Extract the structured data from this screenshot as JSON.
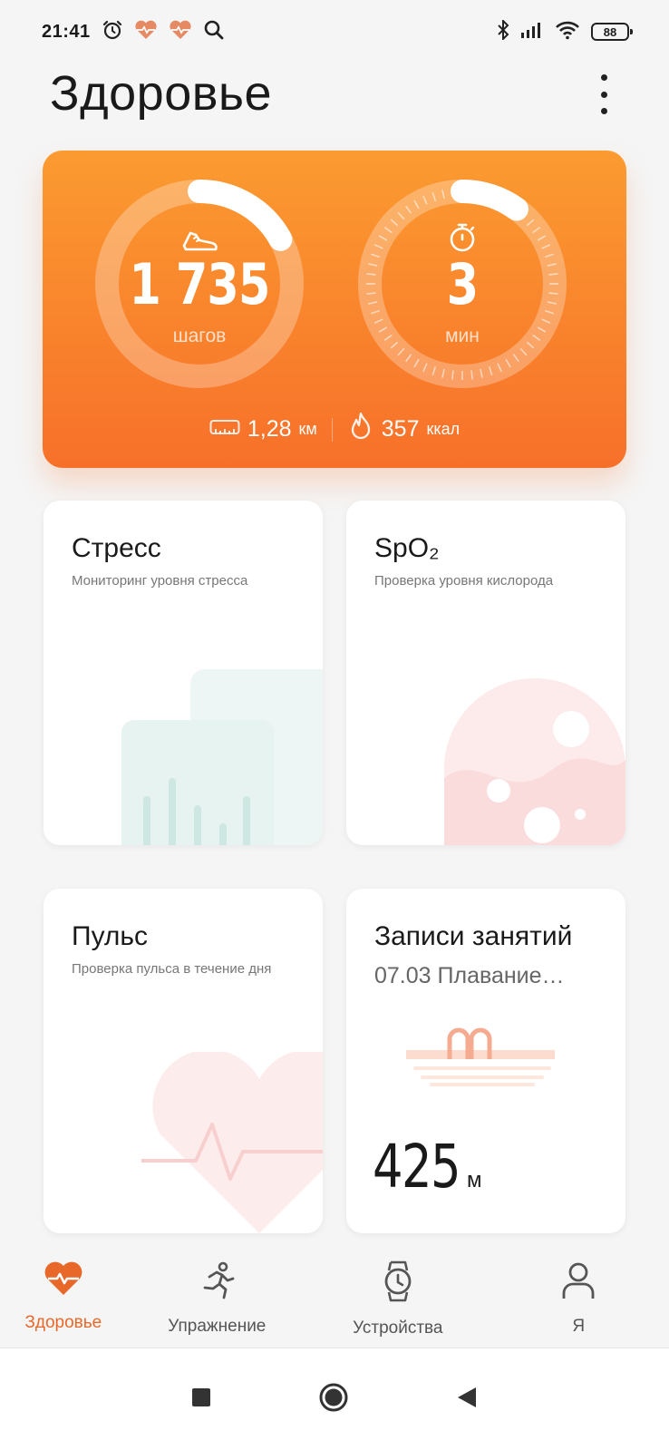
{
  "status_bar": {
    "time": "21:41",
    "battery": "88",
    "icons": [
      "alarm-icon",
      "heart-rate-icon",
      "heart-rate-icon",
      "search-icon",
      "bluetooth-icon",
      "signal-icon",
      "wifi-icon",
      "battery-icon"
    ]
  },
  "header": {
    "title": "Здоровье",
    "menu_icon": "more-vertical-icon"
  },
  "activity": {
    "steps_value": "1 735",
    "steps_unit": "шагов",
    "steps_progress": 0.17,
    "time_value": "3",
    "time_unit": "мин",
    "time_progress": 0.1,
    "distance_value": "1,28",
    "distance_unit": "км",
    "calories_value": "357",
    "calories_unit": "ккал",
    "colors": {
      "gradient_top": "#fb9b30",
      "gradient_bottom": "#f7702a"
    }
  },
  "tiles": {
    "stress": {
      "title": "Стресс",
      "subtitle": "Мониторинг уровня стресса"
    },
    "spo2": {
      "title": "SpO₂",
      "subtitle": "Проверка уровня кислорода"
    },
    "pulse": {
      "title": "Пульс",
      "subtitle": "Проверка пульса в течение дня"
    },
    "workouts": {
      "title": "Записи занятий",
      "subtitle": "07.03 Плавание…",
      "value": "425",
      "unit": "м"
    }
  },
  "bottom_nav": [
    {
      "label": "Здоровье",
      "icon": "heart-pulse-icon",
      "active": true
    },
    {
      "label": "Упражнение",
      "icon": "running-icon",
      "active": false
    },
    {
      "label": "Устройства",
      "icon": "watch-icon",
      "active": false
    },
    {
      "label": "Я",
      "icon": "person-icon",
      "active": false
    }
  ],
  "accent_color": "#e8682a"
}
